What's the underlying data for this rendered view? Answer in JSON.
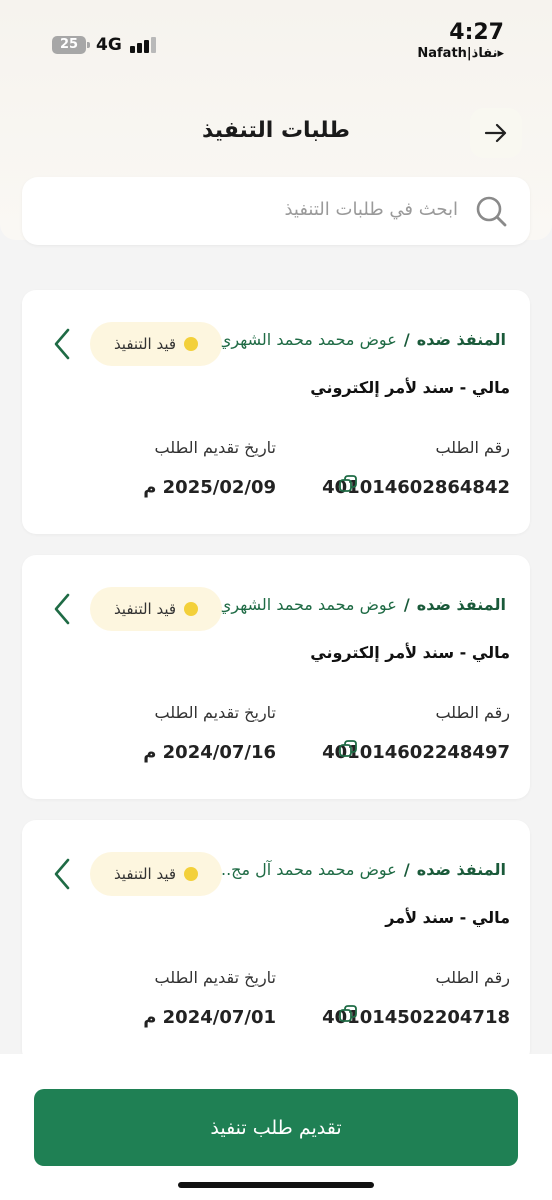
{
  "status_bar": {
    "battery": "25",
    "network": "4G",
    "time": "4:27",
    "carrier": "Nafath|نفاذ▸"
  },
  "header": {
    "title": "طلبات التنفيذ"
  },
  "search": {
    "placeholder": "ابحث في طلبات التنفيذ"
  },
  "colors": {
    "accent": "#1f8054",
    "badge_bg": "#fdf6df",
    "badge_dot": "#f3d03a",
    "label_green": "#1a5a3a"
  },
  "requests": [
    {
      "executed_against_label": "المنفذ ضده",
      "separator": "/",
      "party_name": "عوض محمد محمد الشهري",
      "status": "قيد التنفيذ",
      "type": "مالي - سند لأمر إلكتروني",
      "request_number_label": "رقم الطلب",
      "request_number": "401014602864842",
      "date_label": "تاريخ تقديم الطلب",
      "date": "2025/02/09 م"
    },
    {
      "executed_against_label": "المنفذ ضده",
      "separator": "/",
      "party_name": "عوض محمد محمد الشهري",
      "status": "قيد التنفيذ",
      "type": "مالي - سند لأمر إلكتروني",
      "request_number_label": "رقم الطلب",
      "request_number": "401014602248497",
      "date_label": "تاريخ تقديم الطلب",
      "date": "2024/07/16 م"
    },
    {
      "executed_against_label": "المنفذ ضده",
      "separator": "/",
      "party_name": "عوض  محمد محمد آل مج...",
      "status": "قيد التنفيذ",
      "type": "مالي - سند لأمر",
      "request_number_label": "رقم الطلب",
      "request_number": "401014502204718",
      "date_label": "تاريخ تقديم الطلب",
      "date": "2024/07/01 م"
    }
  ],
  "footer": {
    "submit_label": "تقديم طلب تنفيذ"
  }
}
